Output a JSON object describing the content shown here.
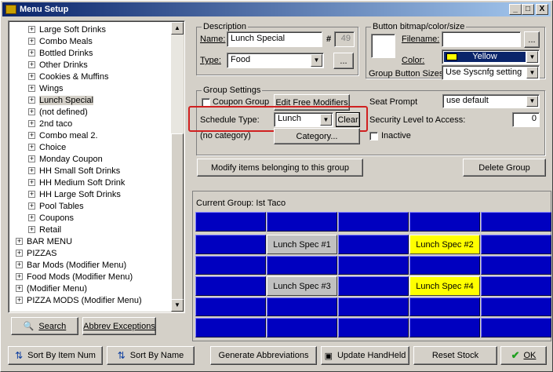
{
  "window": {
    "title": "Menu Setup",
    "min": "_",
    "max": "□",
    "close": "X"
  },
  "tree": {
    "items": [
      {
        "label": "Large Soft Drinks",
        "indent": true
      },
      {
        "label": "Combo Meals",
        "indent": true
      },
      {
        "label": "Bottled Drinks",
        "indent": true
      },
      {
        "label": "Other Drinks",
        "indent": true
      },
      {
        "label": "Cookies & Muffins",
        "indent": true
      },
      {
        "label": "Wings",
        "indent": true
      },
      {
        "label": "Lunch Special",
        "indent": true,
        "selected": true
      },
      {
        "label": "(not defined)",
        "indent": true
      },
      {
        "label": "2nd taco",
        "indent": true
      },
      {
        "label": "Combo meal 2.",
        "indent": true
      },
      {
        "label": "Choice",
        "indent": true
      },
      {
        "label": "Monday Coupon",
        "indent": true
      },
      {
        "label": "HH Small Soft Drinks",
        "indent": true
      },
      {
        "label": "HH Medium Soft Drink",
        "indent": true
      },
      {
        "label": "HH Large Soft Drinks",
        "indent": true
      },
      {
        "label": "Pool Tables",
        "indent": true
      },
      {
        "label": "Coupons",
        "indent": true
      },
      {
        "label": "Retail",
        "indent": true
      },
      {
        "label": "BAR MENU",
        "indent": false
      },
      {
        "label": "PIZZAS",
        "indent": false
      },
      {
        "label": "Bar Mods  (Modifier Menu)",
        "indent": false
      },
      {
        "label": "Food Mods  (Modifier Menu)",
        "indent": false
      },
      {
        "label": "(Modifier Menu)",
        "indent": false
      },
      {
        "label": "PIZZA MODS  (Modifier Menu)",
        "indent": false
      }
    ],
    "expander": "+"
  },
  "left_buttons": {
    "search": "Search",
    "abbrev": "Abbrev Exceptions"
  },
  "description": {
    "group_label": "Description",
    "name_label": "Name:",
    "name_value": "Lunch Special",
    "hash_label": "#",
    "number_value": "49",
    "type_label": "Type:",
    "type_value": "Food",
    "browse": "..."
  },
  "bitmap": {
    "group_label": "Button bitmap/color/size",
    "filename_label": "Filename:",
    "filename_value": "",
    "browse": "...",
    "color_label": "Color:",
    "color_value": "Yellow",
    "color_swatch": "#ffff00",
    "sizes_label": "Group Button Sizes:",
    "sizes_value": "Use Syscnfg setting"
  },
  "group_settings": {
    "group_label": "Group Settings",
    "coupon_label": "Coupon Group",
    "edit_free": "Edit Free Modifiers",
    "seat_prompt_label": "Seat Prompt",
    "seat_prompt_value": "use default",
    "schedule_label": "Schedule Type:",
    "schedule_value": "Lunch",
    "clear": "Clear",
    "security_label": "Security Level to Access:",
    "security_value": "0",
    "category_text": "(no category)",
    "category_button": "Category...",
    "inactive_label": "Inactive",
    "modify_button": "Modify items belonging to this group",
    "delete_button": "Delete Group"
  },
  "grid": {
    "current_label": "Current Group:  Ist Taco",
    "blue": "#0000c0",
    "rows": [
      [
        "",
        "",
        "",
        "",
        ""
      ],
      [
        "",
        "Lunch Spec #1",
        "",
        "Lunch Spec #2",
        ""
      ],
      [
        "",
        "",
        "",
        "",
        ""
      ],
      [
        "",
        "Lunch Spec #3",
        "",
        "Lunch Spec #4",
        ""
      ],
      [
        "",
        "",
        "",
        "",
        ""
      ],
      [
        "",
        "",
        "",
        "",
        ""
      ]
    ]
  },
  "bottom_buttons": {
    "sort_num": "Sort By Item Num",
    "sort_name": "Sort By Name",
    "gen_abbrev": "Generate Abbreviations",
    "update_hh": "Update HandHeld",
    "reset_stock": "Reset Stock",
    "ok": "OK"
  }
}
